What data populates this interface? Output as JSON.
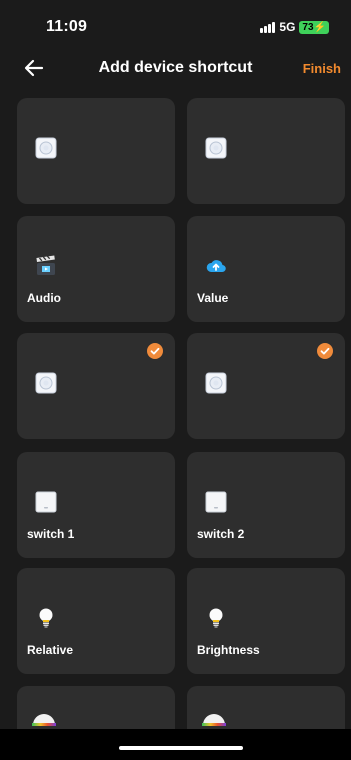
{
  "status": {
    "time": "11:09",
    "network": "5G",
    "battery": "73"
  },
  "header": {
    "title": "Add device shortcut",
    "finish_label": "Finish"
  },
  "cards": [
    {
      "label": "",
      "icon": "round-button-icon",
      "checked": false
    },
    {
      "label": "",
      "icon": "round-button-icon",
      "checked": false
    },
    {
      "label": "Audio",
      "icon": "clapperboard-icon",
      "checked": false
    },
    {
      "label": "Value",
      "icon": "cloud-upload-icon",
      "checked": false
    },
    {
      "label": "",
      "icon": "round-button-icon",
      "checked": true
    },
    {
      "label": "",
      "icon": "round-button-icon",
      "checked": true
    },
    {
      "label": "switch 1",
      "icon": "wall-switch-icon",
      "checked": false
    },
    {
      "label": "switch 2",
      "icon": "wall-switch-icon",
      "checked": false
    },
    {
      "label": "Relative",
      "icon": "light-bulb-icon",
      "checked": false
    },
    {
      "label": "Brightness",
      "icon": "light-bulb-icon",
      "checked": false
    },
    {
      "label": "",
      "icon": "rgb-lamp-icon",
      "checked": false
    },
    {
      "label": "",
      "icon": "rgb-lamp-icon",
      "checked": false
    }
  ],
  "colors": {
    "accent": "#f28a2e",
    "background": "#1b1b1b",
    "card": "#2e2e2e"
  }
}
